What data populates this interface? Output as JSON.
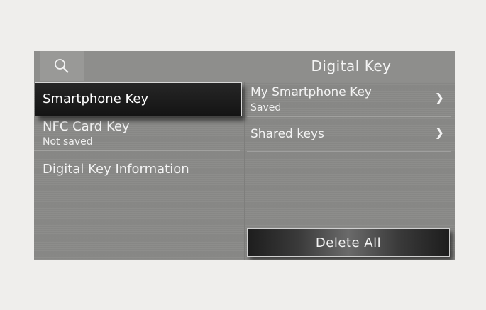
{
  "header": {
    "title": "Digital Key",
    "search_icon": "search-icon"
  },
  "left_menu": {
    "selected_label": "Smartphone Key",
    "items": [
      {
        "label": "NFC Card Key",
        "sub": "Not saved"
      },
      {
        "label": "Digital Key Information"
      }
    ]
  },
  "right_menu": {
    "items": [
      {
        "label": "My Smartphone Key",
        "sub": "Saved",
        "chevron": "❯"
      },
      {
        "label": "Shared keys",
        "chevron": "❯"
      }
    ],
    "delete_label": "Delete All"
  },
  "colors": {
    "page_bg": "#efeeec",
    "screen_bg": "#8a8a88",
    "selected_bg": "#1a1a1a",
    "text": "#f3f3f3"
  }
}
